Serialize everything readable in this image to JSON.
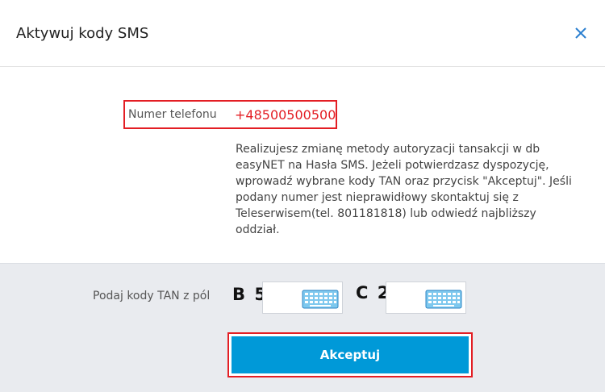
{
  "dialog": {
    "title": "Aktywuj kody SMS",
    "close_icon": "close-icon"
  },
  "phone": {
    "label": "Numer telefonu",
    "value": "+48500500500"
  },
  "info_text": "Realizujesz zmianę metody autoryzacji tansakcji w db easyNET na Hasła SMS. Jeżeli potwierdzasz dyspozycję, wprowadź wybrane kody TAN oraz przycisk \"Akceptuj\". Jeśli podany numer jest nieprawidłowy skontaktuj się z Teleserwisem(tel. 801181818) lub odwiedź najbliższy oddział.",
  "tan": {
    "label": "Podaj kody TAN z pól",
    "fields": [
      {
        "code": "B 5",
        "value": "",
        "icon": "keyboard-icon"
      },
      {
        "code": "C 2",
        "value": "",
        "icon": "keyboard-icon"
      }
    ]
  },
  "accept_button": "Akceptuj",
  "colors": {
    "accent": "#0099d8",
    "highlight": "#e31e24",
    "footer_bg": "#e9ebef"
  }
}
